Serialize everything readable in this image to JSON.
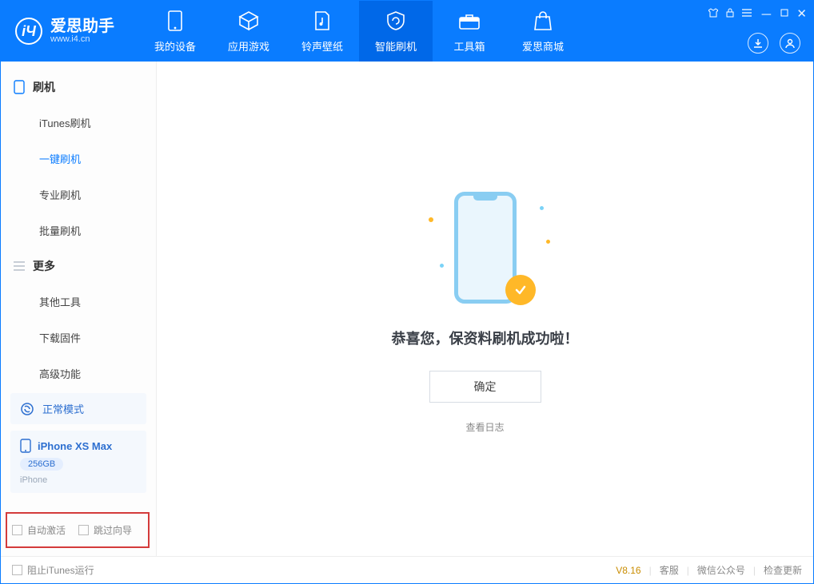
{
  "brand": {
    "name": "爱思助手",
    "site": "www.i4.cn"
  },
  "top_nav": {
    "device": "我的设备",
    "apps": "应用游戏",
    "ringtone": "铃声壁纸",
    "flash": "智能刷机",
    "toolbox": "工具箱",
    "store": "爱思商城"
  },
  "sidebar": {
    "section_flash": "刷机",
    "items_flash": {
      "itunes": "iTunes刷机",
      "oneclick": "一键刷机",
      "pro": "专业刷机",
      "batch": "批量刷机"
    },
    "section_more": "更多",
    "items_more": {
      "other": "其他工具",
      "firmware": "下载固件",
      "advanced": "高级功能"
    },
    "mode_card": "正常模式",
    "device_name": "iPhone XS Max",
    "device_capacity": "256GB",
    "device_type": "iPhone",
    "checkbox_activate": "自动激活",
    "checkbox_skip": "跳过向导"
  },
  "main": {
    "success_text": "恭喜您，保资料刷机成功啦！",
    "ok_button": "确定",
    "view_log": "查看日志"
  },
  "footer": {
    "stop_itunes": "阻止iTunes运行",
    "version": "V8.16",
    "support": "客服",
    "wechat": "微信公众号",
    "update": "检查更新"
  }
}
